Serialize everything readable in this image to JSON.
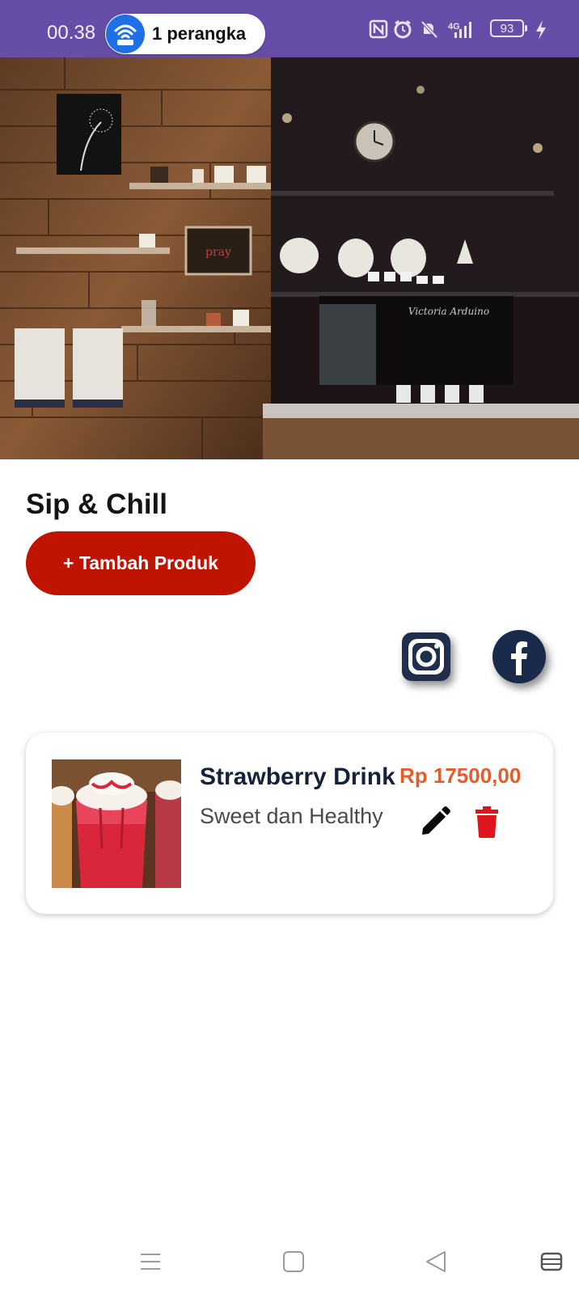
{
  "status_bar": {
    "time": "00.38",
    "hotspot_text": "1 perangka",
    "network": "4G",
    "battery": "93",
    "bg_color": "#664ea8",
    "icons": [
      "hotspot-icon",
      "nfc-icon",
      "alarm-icon",
      "mute-icon",
      "signal-icon",
      "battery-icon",
      "charging-icon"
    ]
  },
  "hero": {
    "image": "coffee-shop-interior-photo"
  },
  "shop": {
    "name": "Sip & Chill",
    "add_button_label": "+ Tambah Produk",
    "accent_color": "#c01403"
  },
  "social": {
    "items": [
      "instagram-icon",
      "facebook-icon"
    ]
  },
  "products": [
    {
      "name": "Strawberry Drink",
      "price": "Rp 17500,00",
      "description": "Sweet dan Healthy",
      "image": "strawberry-drink-photo",
      "price_color": "#e65c2a"
    }
  ],
  "nav_bar": {
    "icons": [
      "menu-icon",
      "home-icon",
      "back-icon",
      "recents-icon"
    ]
  }
}
